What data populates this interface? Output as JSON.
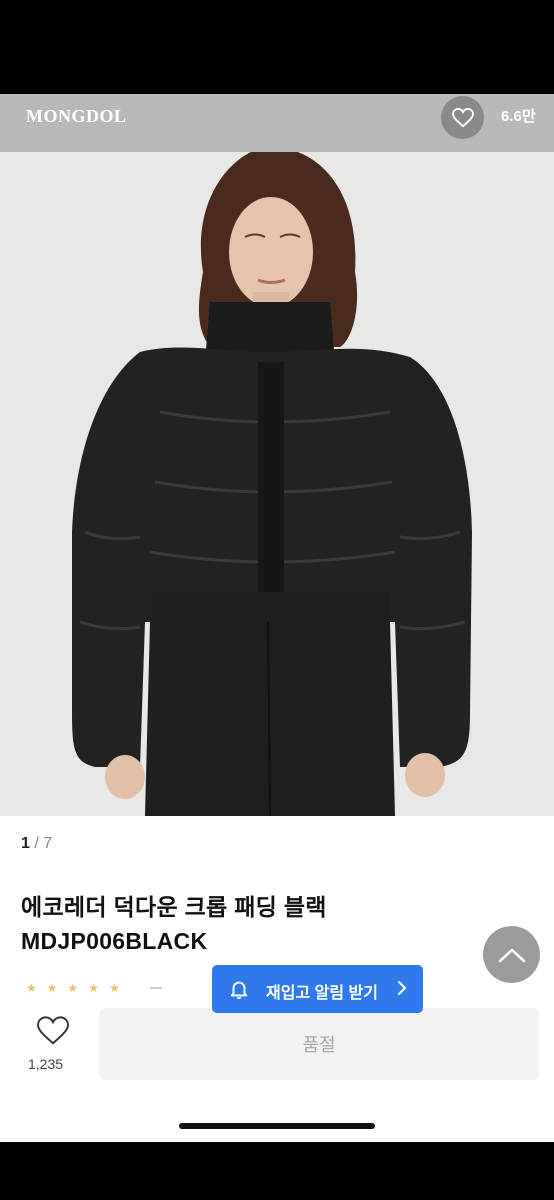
{
  "header": {
    "brand": "MONGDOL",
    "like_count": "6.6만"
  },
  "gallery": {
    "current": "1",
    "separator": " / ",
    "total": "7"
  },
  "product": {
    "title": "에코레더 덕다운 크롭 패딩 블랙 MDJP006BLACK"
  },
  "restock": {
    "label": "재입고 알림 받기"
  },
  "bottom_bar": {
    "wish_count": "1,235",
    "soldout_label": "품절"
  },
  "icons": {
    "like": "heart-icon",
    "scroll_top": "chevron-up-icon",
    "bell": "bell-icon",
    "chevron": "chevron-right-icon",
    "wish": "heart-outline-icon"
  },
  "colors": {
    "header_bg": "#b9b9b9",
    "restock_bg": "#2f79ec",
    "soldout_bg": "#f2f2f2"
  }
}
